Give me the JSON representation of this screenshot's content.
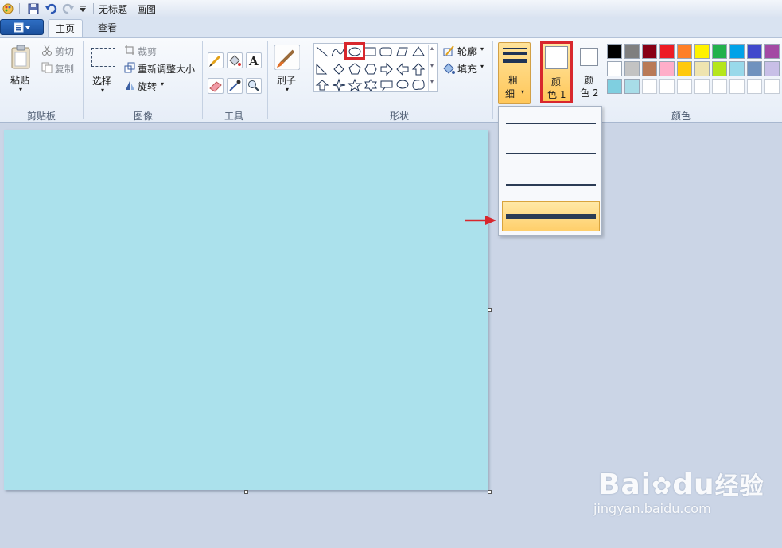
{
  "window": {
    "title": "无标题 - 画图"
  },
  "tabs": {
    "home": "主页",
    "view": "查看"
  },
  "clipboard": {
    "paste": "粘贴",
    "cut": "剪切",
    "copy": "复制",
    "label": "剪贴板"
  },
  "image": {
    "select": "选择",
    "crop": "裁剪",
    "resize": "重新调整大小",
    "rotate": "旋转",
    "label": "图像"
  },
  "tools": {
    "label": "工具"
  },
  "brushes": {
    "label": "刷子"
  },
  "shapes": {
    "outline": "轮廓",
    "fill": "填充",
    "label": "形状"
  },
  "size": {
    "label_top": "粗",
    "label_bottom": "细"
  },
  "color1": {
    "top": "颜",
    "bottom": "色 1"
  },
  "color2": {
    "top": "颜",
    "bottom": "色 2"
  },
  "colors": {
    "label": "颜色",
    "row1": [
      "#000000",
      "#7f7f7f",
      "#880015",
      "#ed1c24",
      "#ff7f27",
      "#fff200",
      "#22b14c",
      "#00a2e8",
      "#3f48cc",
      "#a349a4"
    ],
    "row2": [
      "#ffffff",
      "#c3c3c3",
      "#b97a57",
      "#ffaec9",
      "#ffc90e",
      "#efe4b0",
      "#b5e61d",
      "#99d9ea",
      "#7092be",
      "#c8bfe7"
    ],
    "row3": [
      "#7fcfe0",
      "#a8dde8",
      "#ffffff",
      "#ffffff",
      "#ffffff",
      "#ffffff",
      "#ffffff",
      "#ffffff",
      "#ffffff",
      "#ffffff"
    ]
  },
  "canvas_color": "#abe1ec",
  "size_options": [
    1,
    2,
    3,
    5
  ],
  "selected_size_index": 3,
  "watermark": {
    "brand": "Bai",
    "brand2": "du",
    "cn": "经验",
    "url": "jingyan.baidu.com"
  }
}
